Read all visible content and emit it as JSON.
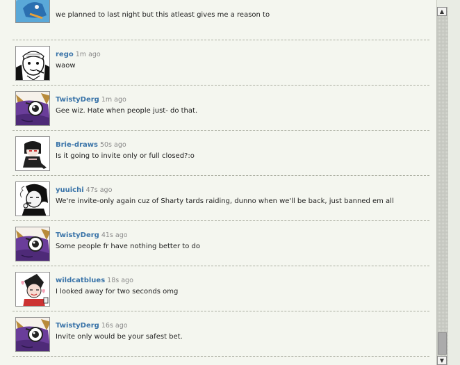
{
  "messages": [
    {
      "name": "",
      "time": "",
      "text": "we planned to last night but this atleast gives me a reason to",
      "avatar_icon": "blue-dragon-avatar-icon"
    },
    {
      "name": "rego",
      "time": "1m ago",
      "text": "waow",
      "avatar_icon": "sketch-character-avatar-icon"
    },
    {
      "name": "TwistyDerg",
      "time": "1m ago",
      "text": "Gee wiz. Hate when people just- do that.",
      "avatar_icon": "purple-dragon-avatar-icon"
    },
    {
      "name": "Brie-draws",
      "time": "50s ago",
      "text": "Is it going to invite only or full closed?:o",
      "avatar_icon": "chibi-character-avatar-icon"
    },
    {
      "name": "yuuichi",
      "time": "47s ago",
      "text": "We're invite-only again cuz of Sharty tards raiding, dunno when we'll be back, just banned em all",
      "avatar_icon": "smoking-character-avatar-icon"
    },
    {
      "name": "TwistyDerg",
      "time": "41s ago",
      "text": "Some people fr have nothing better to do",
      "avatar_icon": "purple-dragon-avatar-icon"
    },
    {
      "name": "wildcatblues",
      "time": "18s ago",
      "text": "I looked away for two seconds omg",
      "avatar_icon": "pink-character-avatar-icon"
    },
    {
      "name": "TwistyDerg",
      "time": "16s ago",
      "text": "Invite only would be your safest bet.",
      "avatar_icon": "purple-dragon-avatar-icon"
    }
  ],
  "scrollbar": {
    "up_glyph": "▲",
    "down_glyph": "▼"
  },
  "colors": {
    "username": "#3973a8",
    "timestamp": "#8a8a8a",
    "background": "#f4f6ef"
  }
}
